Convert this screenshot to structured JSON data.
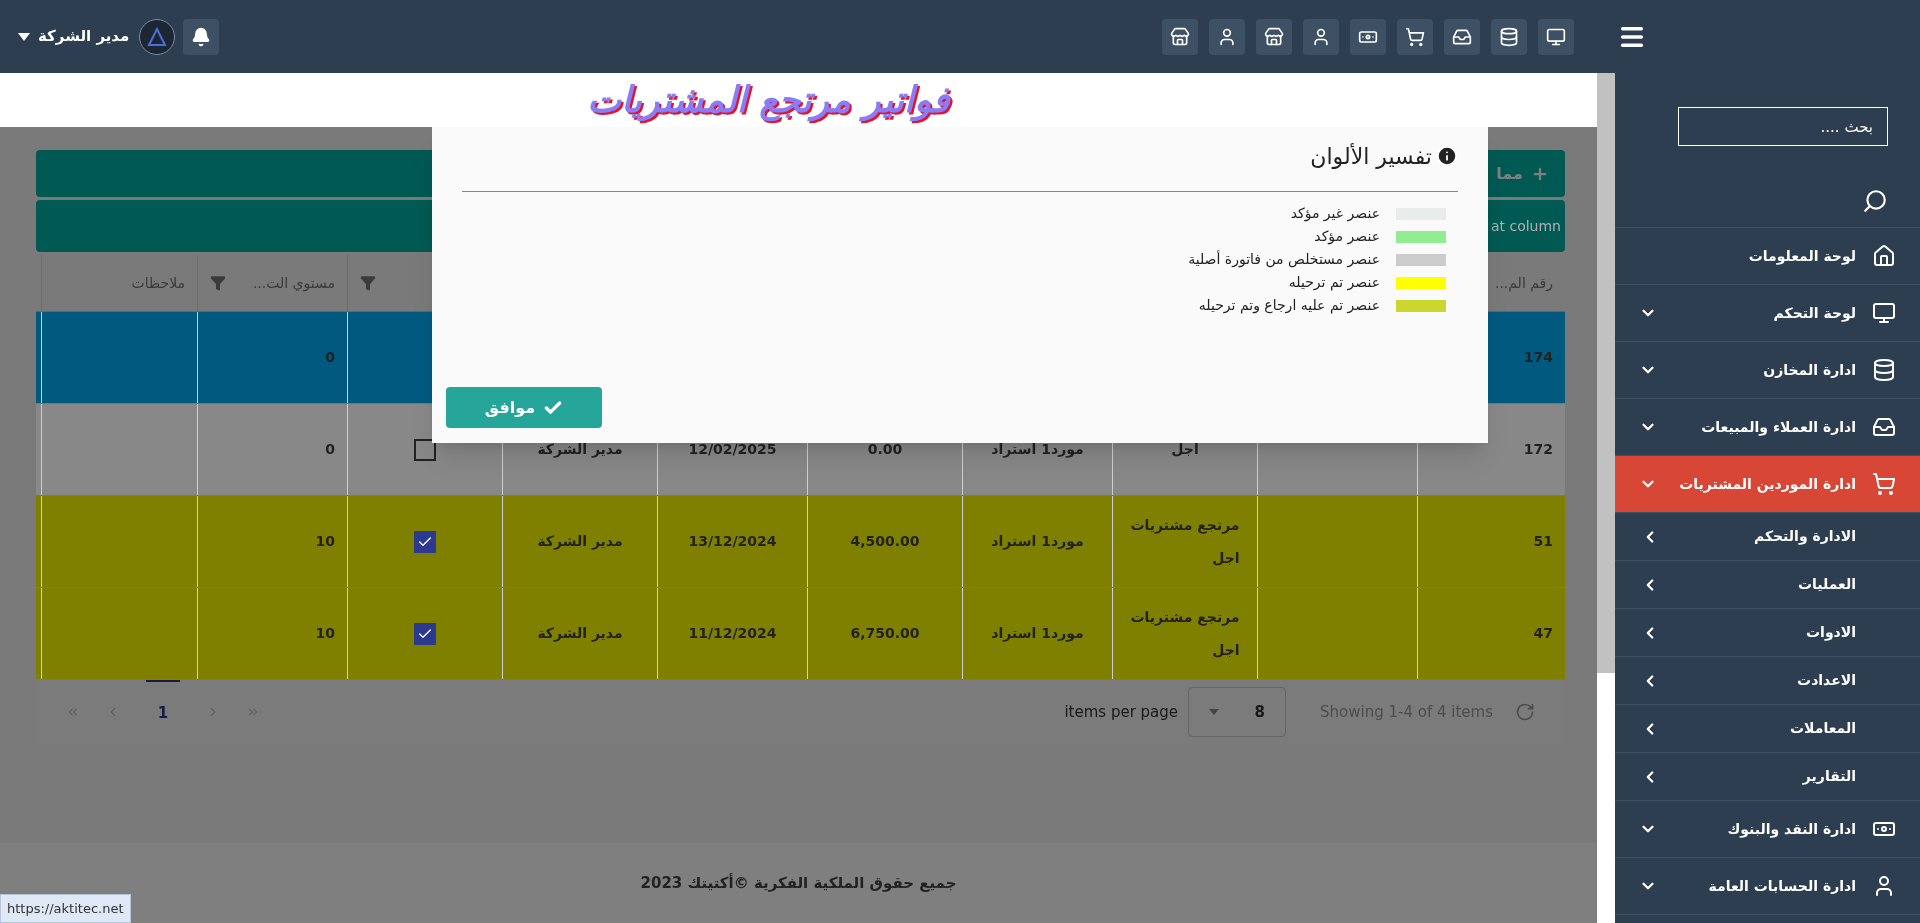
{
  "topbar": {
    "user_name": "مدير الشركة"
  },
  "page_title": "فواتير مرتجع المشتريات",
  "toolbar": {
    "add_button": "مما",
    "group_hint": "at column"
  },
  "table": {
    "columns": [
      {
        "label": "رقم الم..."
      },
      {},
      {},
      {},
      {},
      {},
      {},
      {
        "filter": true
      },
      {
        "label": "مستوي الت...",
        "filter": true
      },
      {
        "label": "ملاحظات"
      }
    ],
    "rows": [
      {
        "number": "174",
        "color": "#005a80",
        "level": "0"
      },
      {
        "number": "172",
        "color": "#888888",
        "type_lines": [
          "اجل"
        ],
        "supplier": "مورد1 استراد",
        "amount": "0.00",
        "date": "12/02/2025",
        "user": "مدير الشركة",
        "checked": false,
        "level": "0"
      },
      {
        "number": "51",
        "color": "#808000",
        "type_lines": [
          "مرتجع مشتريات",
          "اجل"
        ],
        "supplier": "مورد1 استراد",
        "amount": "4,500.00",
        "date": "13/12/2024",
        "user": "مدير الشركة",
        "checked": true,
        "level": "10"
      },
      {
        "number": "47",
        "color": "#808000",
        "type_lines": [
          "مرتجع مشتريات",
          "اجل"
        ],
        "supplier": "مورد1 استراد",
        "amount": "6,750.00",
        "date": "11/12/2024",
        "user": "مدير الشركة",
        "checked": true,
        "level": "10"
      }
    ]
  },
  "pager": {
    "summary": "Showing 1-4 of 4 items",
    "page_size": "8",
    "page_size_label": "items per page",
    "pages": [
      {
        "label": "1",
        "selected": true
      }
    ]
  },
  "footer": "جميع حقوق الملكية الفكرية ©أكتيتك 2023",
  "status_link": "https://aktitec.net",
  "modal": {
    "title": "تفسير الألوان",
    "legend": [
      {
        "label": "عنصر غير مؤكد",
        "color": "#e8ecea"
      },
      {
        "label": "عنصر مؤكد",
        "color": "#90ee90"
      },
      {
        "label": "عنصر مستخلص من فاتورة أصلية",
        "color": "#cccccc"
      },
      {
        "label": "عنصر تم ترحيله",
        "color": "#ffff00"
      },
      {
        "label": "عنصر تم عليه ارجاع وتم ترحيله",
        "color": "#cbd72f"
      }
    ],
    "ok_button": "موافق"
  },
  "sidebar": {
    "search": {
      "placeholder": "بحث ...."
    },
    "items": [
      {
        "label": "لوحة المعلومات",
        "expandable": false,
        "selected": false
      },
      {
        "label": "لوحة التحكم",
        "expandable": true,
        "selected": false
      },
      {
        "label": "ادارة المخازن",
        "expandable": true,
        "selected": false
      },
      {
        "label": "ادارة العملاء والمبيعات",
        "expandable": true,
        "selected": false
      },
      {
        "label": "ادارة الموردين المشتريات",
        "expandable": true,
        "selected": true,
        "children": [
          {
            "label": "الادارة والتحكم"
          },
          {
            "label": "العمليات"
          },
          {
            "label": "الادوات"
          },
          {
            "label": "الاعدادت"
          },
          {
            "label": "المعاملات"
          },
          {
            "label": "التقارير"
          }
        ]
      },
      {
        "label": "ادارة النقد والبنوك",
        "expandable": true,
        "selected": false
      },
      {
        "label": "ادارة الحسابات العامة",
        "expandable": true,
        "selected": false
      }
    ]
  }
}
